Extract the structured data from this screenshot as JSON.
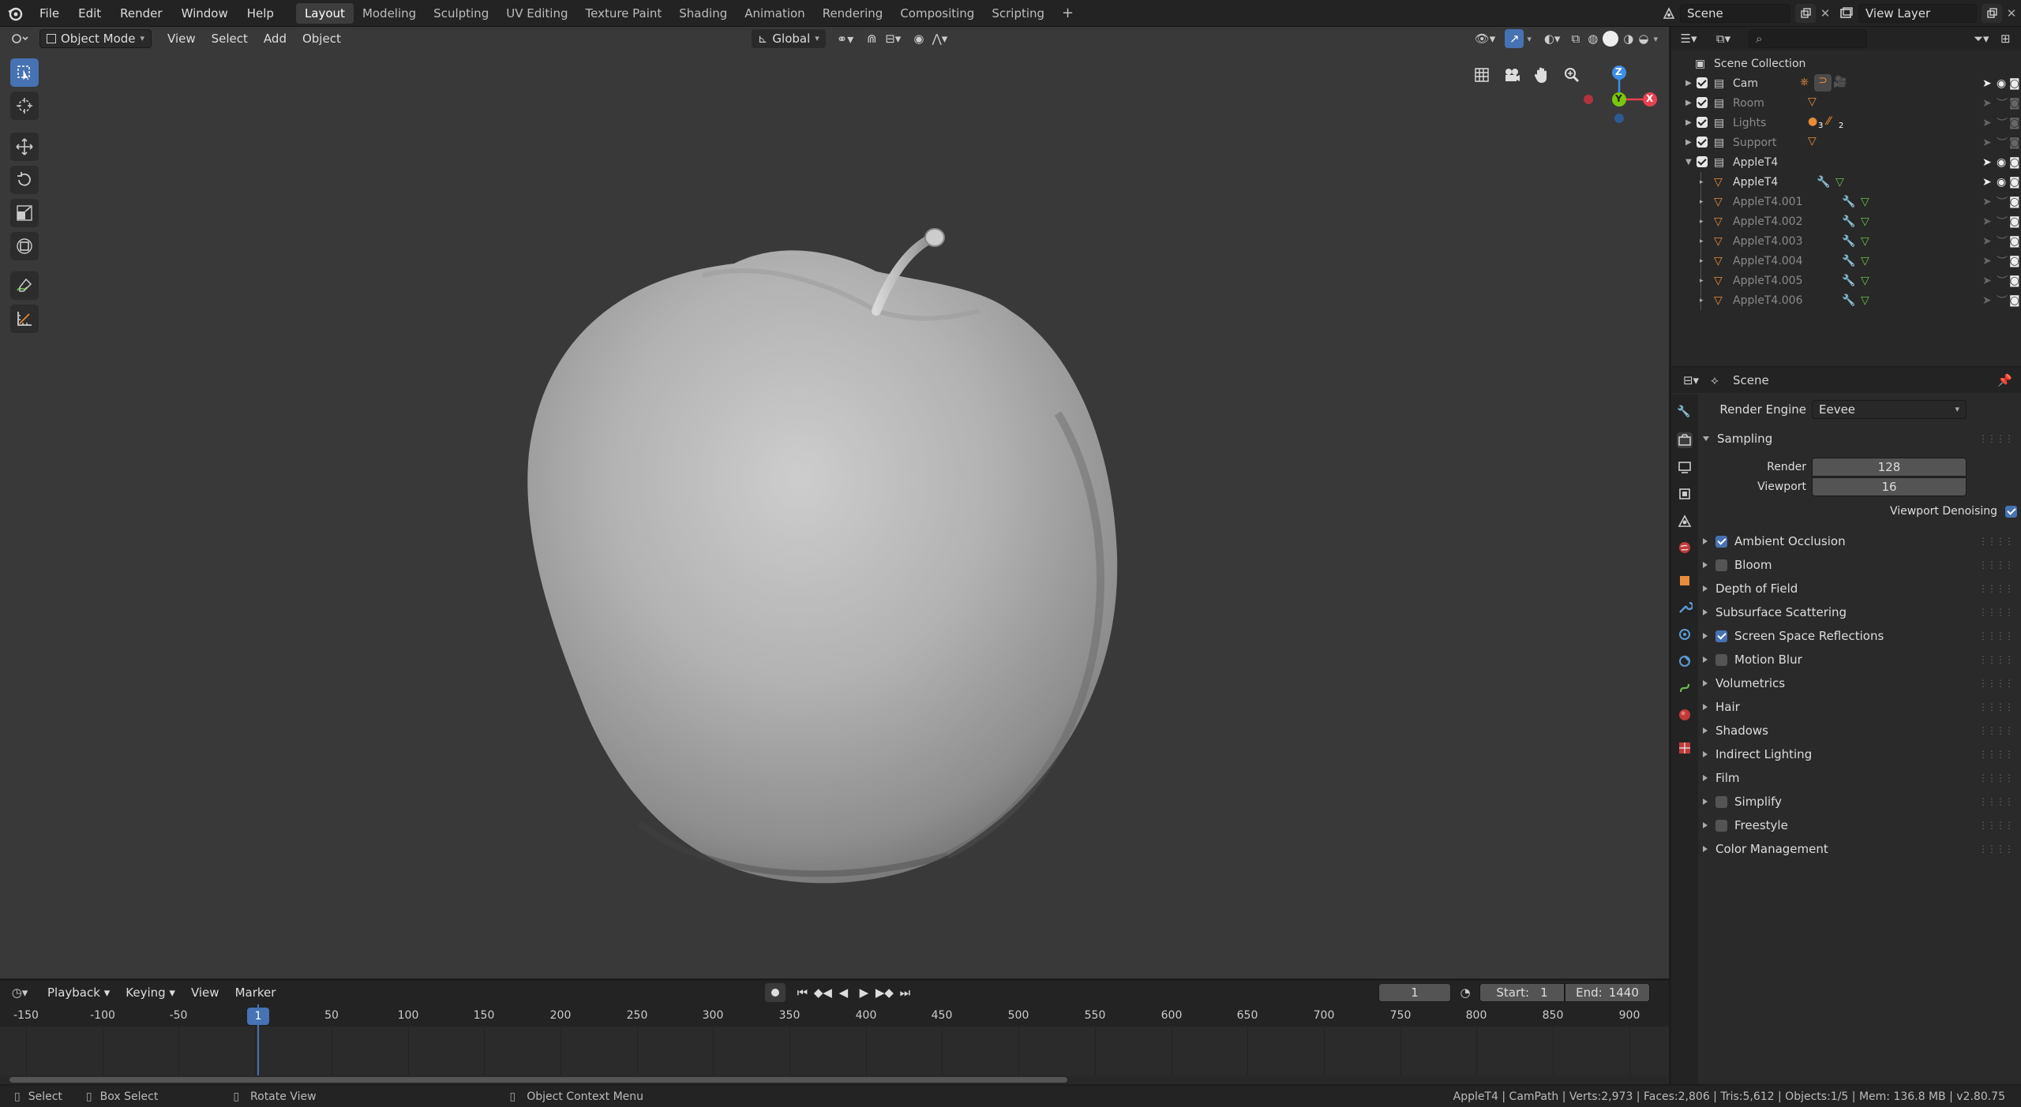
{
  "topbar": {
    "menus": [
      "File",
      "Edit",
      "Render",
      "Window",
      "Help"
    ],
    "workspaces": [
      "Layout",
      "Modeling",
      "Sculpting",
      "UV Editing",
      "Texture Paint",
      "Shading",
      "Animation",
      "Rendering",
      "Compositing",
      "Scripting"
    ],
    "active_workspace": "Layout",
    "add_tab": "+",
    "scene_name": "Scene",
    "view_layer": "View Layer"
  },
  "viewport": {
    "mode": "Object Mode",
    "menus": [
      "View",
      "Select",
      "Add",
      "Object"
    ],
    "transform_orientation": "Global",
    "gizmo_axes": [
      "Z",
      "Y",
      "X"
    ]
  },
  "outliner": {
    "search_placeholder": "",
    "root": "Scene Collection",
    "collections": [
      {
        "name": "Cam",
        "visible": true
      },
      {
        "name": "Room",
        "visible": false
      },
      {
        "name": "Lights",
        "visible": false,
        "badges": [
          "3",
          "2"
        ]
      },
      {
        "name": "Support",
        "visible": false
      },
      {
        "name": "AppleT4",
        "visible": true,
        "expanded": true
      }
    ],
    "objects": [
      {
        "name": "AppleT4",
        "active": true
      },
      {
        "name": "AppleT4.001",
        "active": false
      },
      {
        "name": "AppleT4.002",
        "active": false
      },
      {
        "name": "AppleT4.003",
        "active": false
      },
      {
        "name": "AppleT4.004",
        "active": false
      },
      {
        "name": "AppleT4.005",
        "active": false
      },
      {
        "name": "AppleT4.006",
        "active": false
      }
    ]
  },
  "properties": {
    "context": "Scene",
    "render_engine_label": "Render Engine",
    "render_engine": "Eevee",
    "sampling_label": "Sampling",
    "render_label": "Render",
    "render_samples": "128",
    "viewport_label": "Viewport",
    "viewport_samples": "16",
    "denoising_label": "Viewport Denoising",
    "panels": [
      {
        "label": "Ambient Occlusion",
        "checkbox": true,
        "checked": true
      },
      {
        "label": "Bloom",
        "checkbox": true,
        "checked": false
      },
      {
        "label": "Depth of Field",
        "checkbox": false
      },
      {
        "label": "Subsurface Scattering",
        "checkbox": false
      },
      {
        "label": "Screen Space Reflections",
        "checkbox": true,
        "checked": true
      },
      {
        "label": "Motion Blur",
        "checkbox": true,
        "checked": false
      },
      {
        "label": "Volumetrics",
        "checkbox": false
      },
      {
        "label": "Hair",
        "checkbox": false
      },
      {
        "label": "Shadows",
        "checkbox": false
      },
      {
        "label": "Indirect Lighting",
        "checkbox": false
      },
      {
        "label": "Film",
        "checkbox": false
      },
      {
        "label": "Simplify",
        "checkbox": true,
        "checked": false
      },
      {
        "label": "Freestyle",
        "checkbox": true,
        "checked": false
      },
      {
        "label": "Color Management",
        "checkbox": false
      }
    ]
  },
  "timeline": {
    "menus": [
      "Playback",
      "Keying",
      "View",
      "Marker"
    ],
    "current_frame": "1",
    "start_label": "Start:",
    "start": "1",
    "end_label": "End:",
    "end": "1440",
    "ruler": [
      "-150",
      "-100",
      "-50",
      "1",
      "50",
      "100",
      "150",
      "200",
      "250",
      "300",
      "350",
      "400",
      "450",
      "500",
      "550",
      "600",
      "650",
      "700",
      "750",
      "800",
      "850",
      "900"
    ]
  },
  "statusbar": {
    "select": "Select",
    "box_select": "Box Select",
    "rotate_view": "Rotate View",
    "context_menu": "Object Context Menu",
    "stats": "AppleT4 | CamPath | Verts:2,973 | Faces:2,806 | Tris:5,612 | Objects:1/5 | Mem: 136.8 MB | v2.80.75"
  },
  "colors": {
    "accent": "#4772b3",
    "object_orange": "#e88b3a",
    "mesh_green": "#6abf4b",
    "axis_x": "#e8414f",
    "axis_y": "#7ac70c",
    "axis_z": "#3c8ee8"
  }
}
